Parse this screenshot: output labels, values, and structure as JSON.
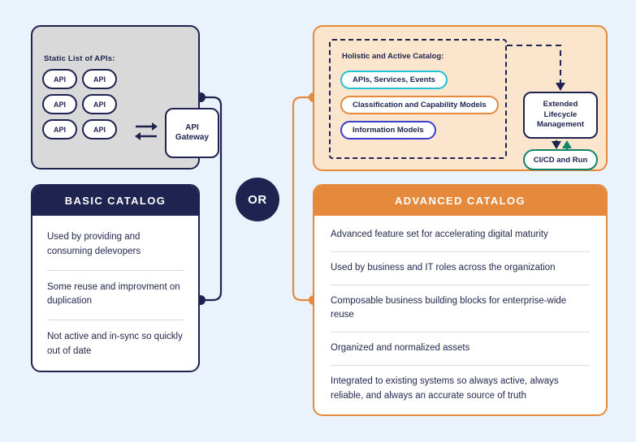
{
  "theme": {
    "background": "#eaf2fc",
    "navy": "#1e2350",
    "orange": "#e58a3c",
    "peach": "#fce5cd",
    "grey": "#d9d9d9",
    "cyan": "#1ec2d6",
    "indigo": "#3b3bd0",
    "green": "#10836a",
    "white": "#ffffff",
    "divider": "#dcdde3"
  },
  "basic_side": {
    "static_box": {
      "title": "Static List of APIs:",
      "api_pills": [
        "API",
        "API",
        "API",
        "API",
        "API",
        "API"
      ],
      "exchange_icon": "bidirectional-exchange-arrows",
      "gateway_label": "API\nGateway",
      "gateway_line1": "API",
      "gateway_line2": "Gateway"
    },
    "card": {
      "header": "BASIC CATALOG",
      "items": [
        "Used by providing and consuming delevopers",
        "Some reuse and improvment on duplication",
        "Not active and in-sync so quickly out of date"
      ]
    }
  },
  "divider_badge": {
    "label": "OR"
  },
  "advanced_side": {
    "panel": {
      "dashed_group_title": "Holistic and Active Catalog:",
      "pills": [
        {
          "label": "APIs,  Services, Events",
          "border_color": "#1ec2d6"
        },
        {
          "label": "Classification and Capability Models",
          "border_color": "#e58a3c"
        },
        {
          "label": "Information Models",
          "border_color": "#3b3bd0"
        }
      ],
      "lifecycle_box": {
        "line1": "Extended",
        "line2": "Lifecycle",
        "line3": "Management"
      },
      "cicd_box": {
        "label": "CI/CD and Run",
        "border_color": "#10836a"
      },
      "arrows": {
        "dashed_down_to_lifecycle": "dashed-arrow-down-icon",
        "lifecycle_to_cicd": "arrow-down-icon",
        "cicd_to_lifecycle": "arrow-up-icon"
      }
    },
    "card": {
      "header": "ADVANCED CATALOG",
      "items": [
        "Advanced feature set for accelerating digital maturity",
        "Used by business and IT roles across the organization",
        "Composable business building blocks for enterprise-wide reuse",
        "Organized and normalized assets",
        "Integrated to existing systems so always active, always reliable, and always an accurate source of truth"
      ]
    }
  }
}
